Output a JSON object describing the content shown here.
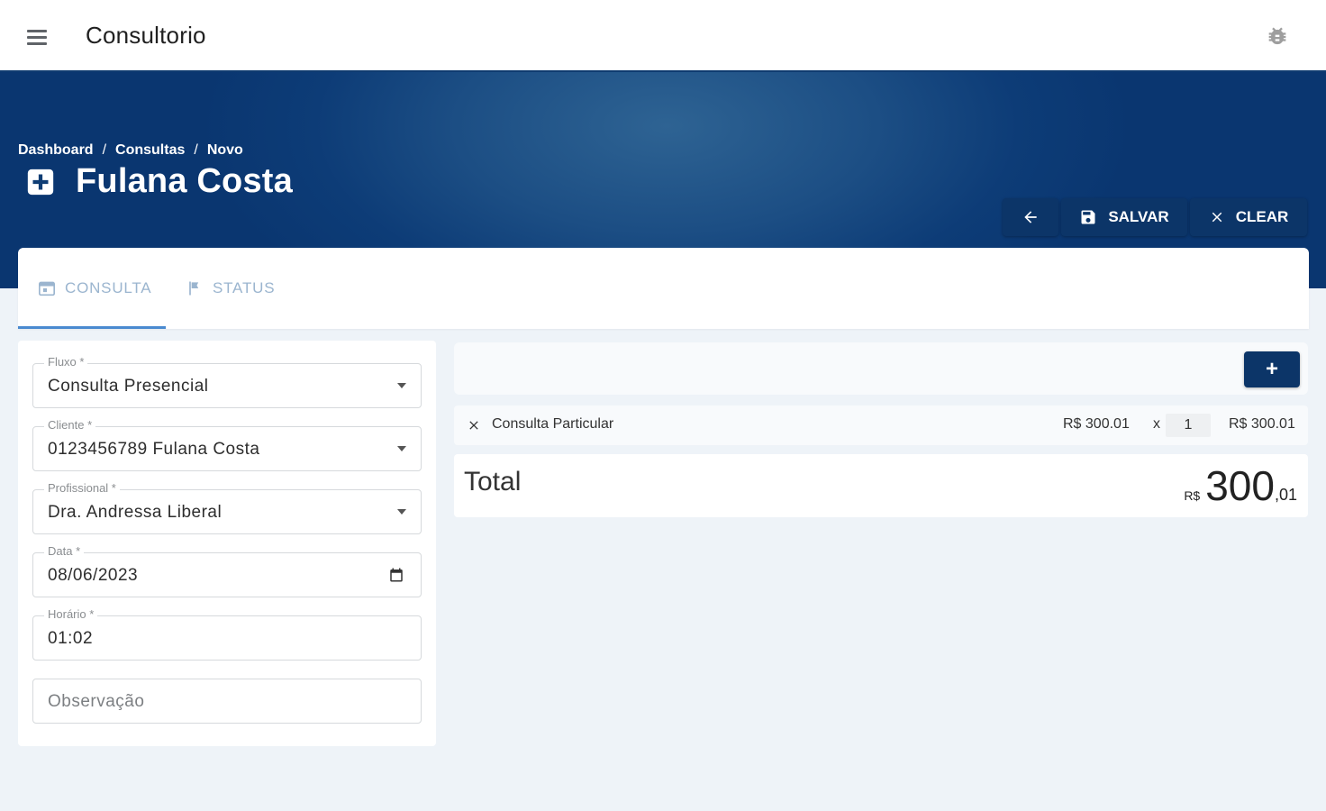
{
  "app": {
    "title": "Consultorio"
  },
  "breadcrumb": [
    "Dashboard",
    "Consultas",
    "Novo"
  ],
  "page": {
    "title": "Fulana Costa"
  },
  "actions": {
    "save_label": "SALVAR",
    "clear_label": "CLEAR"
  },
  "tabs": [
    {
      "label": "CONSULTA",
      "icon": "calendar-icon",
      "active": true
    },
    {
      "label": "STATUS",
      "icon": "status-flag-icon",
      "active": false
    }
  ],
  "form": {
    "fluxo": {
      "label": "Fluxo *",
      "value": "Consulta Presencial"
    },
    "cliente": {
      "label": "Cliente *",
      "value": "0123456789 Fulana Costa"
    },
    "profissional": {
      "label": "Profissional *",
      "value": "Dra. Andressa Liberal"
    },
    "data": {
      "label": "Data *",
      "value": "08/06/2023"
    },
    "horario": {
      "label": "Horário *",
      "value": "01:02"
    },
    "observacao": {
      "placeholder": "Observação"
    }
  },
  "items": [
    {
      "name": "Consulta Particular",
      "price": "R$ 300.01",
      "multiplier": "x",
      "quantity": "1",
      "total": "R$ 300.01"
    }
  ],
  "total": {
    "label": "Total",
    "currency": "R$",
    "integer": "300",
    "decimals": ",01"
  },
  "colors": {
    "primary": "#0c3568",
    "tab_text": "#9bb5cf",
    "tab_indicator": "#4a8ad0",
    "background": "#eef3f8"
  }
}
